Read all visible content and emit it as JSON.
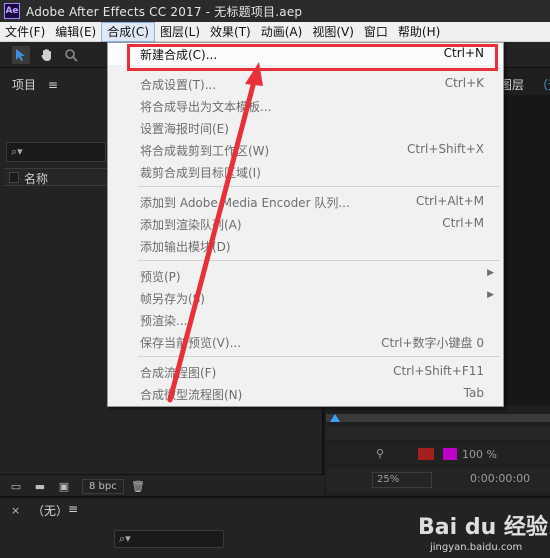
{
  "window": {
    "title": "Adobe After Effects CC 2017 - 无标题项目.aep",
    "logo_text": "Ae"
  },
  "menubar": [
    {
      "label": "文件(F)"
    },
    {
      "label": "编辑(E)"
    },
    {
      "label": "合成(C)",
      "active": true
    },
    {
      "label": "图层(L)"
    },
    {
      "label": "效果(T)"
    },
    {
      "label": "动画(A)"
    },
    {
      "label": "视图(V)"
    },
    {
      "label": "窗口"
    },
    {
      "label": "帮助(H)"
    }
  ],
  "project_panel": {
    "tab_label": "项目",
    "tab_menu": "≡",
    "search_icon_text": "⌕▾",
    "name_column": "名称",
    "bpc_label": "8 bpc"
  },
  "right_panel": {
    "layer_tab": "图层",
    "layer_tab2": "（无",
    "zoom_percent": "100 %",
    "zoom_dropdown": "25%",
    "timecode": "0:00:00:00"
  },
  "timeline_panel": {
    "close": "×",
    "tab_label": "（无）",
    "tab_menu": "≡",
    "search_icon_text": "⌕▾"
  },
  "composition_menu": {
    "items": [
      {
        "label": "新建合成(C)...",
        "shortcut": "Ctrl+N",
        "enabled": true,
        "highlight": true
      },
      {
        "separator": true
      },
      {
        "label": "合成设置(T)...",
        "shortcut": "Ctrl+K",
        "enabled": false
      },
      {
        "label": "将合成导出为文本模板...",
        "shortcut": "",
        "enabled": false
      },
      {
        "label": "设置海报时间(E)",
        "shortcut": "",
        "enabled": false
      },
      {
        "label": "将合成裁剪到工作区(W)",
        "shortcut": "Ctrl+Shift+X",
        "enabled": false
      },
      {
        "label": "裁剪合成到目标区域(I)",
        "shortcut": "",
        "enabled": false
      },
      {
        "separator": true
      },
      {
        "label": "添加到 Adobe Media Encoder 队列...",
        "shortcut": "Ctrl+Alt+M",
        "enabled": false
      },
      {
        "label": "添加到渲染队列(A)",
        "shortcut": "Ctrl+M",
        "enabled": false
      },
      {
        "label": "添加输出模块(D)",
        "shortcut": "",
        "enabled": false
      },
      {
        "separator": true
      },
      {
        "label": "预览(P)",
        "shortcut": "",
        "enabled": false,
        "submenu": true
      },
      {
        "label": "帧另存为(S)",
        "shortcut": "",
        "enabled": false,
        "submenu": true
      },
      {
        "label": "预渲染...",
        "shortcut": "",
        "enabled": false
      },
      {
        "label": "保存当前预览(V)...",
        "shortcut": "Ctrl+数字小键盘 0",
        "enabled": false
      },
      {
        "separator": true
      },
      {
        "label": "合成流程图(F)",
        "shortcut": "Ctrl+Shift+F11",
        "enabled": false
      },
      {
        "label": "合成微型流程图(N)",
        "shortcut": "Tab",
        "enabled": false
      }
    ]
  },
  "watermark": {
    "logo": "Bai du 经验",
    "url": "jingyan.baidu.com"
  },
  "colors": {
    "annotation_red": "#e8303a",
    "accent_blue": "#3aa1ff"
  }
}
